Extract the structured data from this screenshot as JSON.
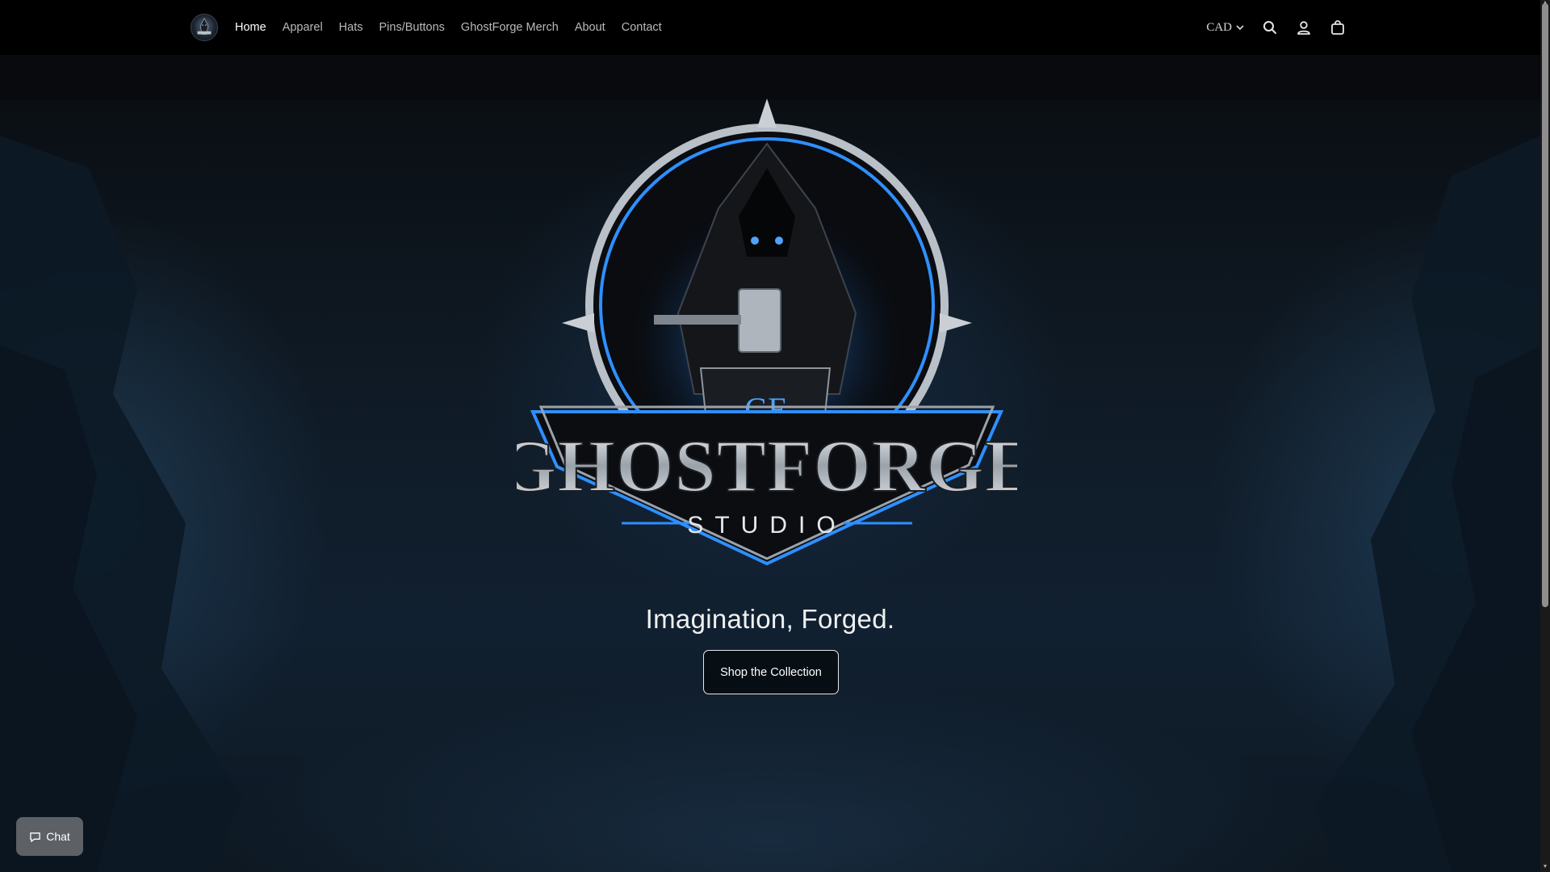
{
  "nav": {
    "items": [
      {
        "label": "Home",
        "active": true
      },
      {
        "label": "Apparel",
        "active": false
      },
      {
        "label": "Hats",
        "active": false
      },
      {
        "label": "Pins/Buttons",
        "active": false
      },
      {
        "label": "GhostForge Merch",
        "active": false
      },
      {
        "label": "About",
        "active": false
      },
      {
        "label": "Contact",
        "active": false
      }
    ]
  },
  "header": {
    "currency": "CAD",
    "icons": [
      "search-icon",
      "account-icon",
      "cart-icon"
    ]
  },
  "hero": {
    "brand_main": "GHOSTFORGE",
    "brand_sub": "STUDIO",
    "laptop_monogram": "GF",
    "tagline": "Imagination, Forged.",
    "cta_label": "Shop the Collection"
  },
  "chat": {
    "label": "Chat"
  },
  "colors": {
    "accent": "#2f8fff",
    "background": "#07080a",
    "header": "#000000"
  }
}
